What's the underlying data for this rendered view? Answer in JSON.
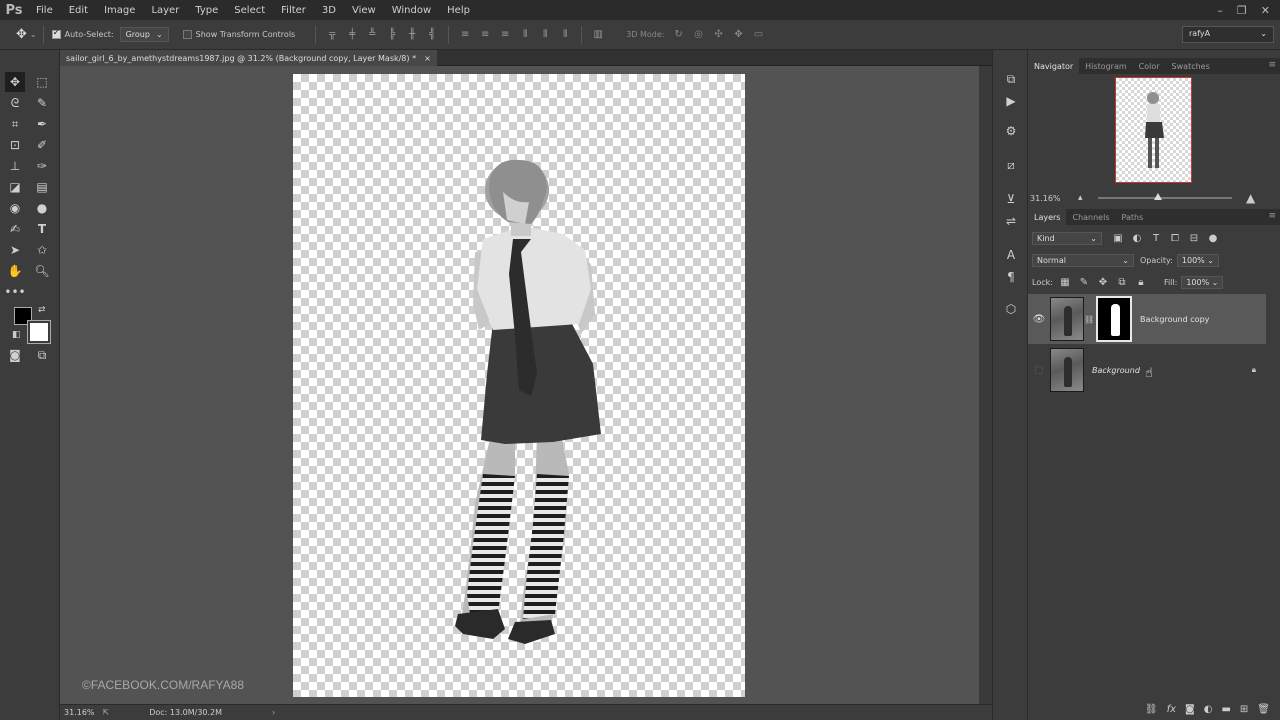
{
  "app": {
    "logo": "Ps"
  },
  "menu": [
    "File",
    "Edit",
    "Image",
    "Layer",
    "Type",
    "Select",
    "Filter",
    "3D",
    "View",
    "Window",
    "Help"
  ],
  "window_controls": [
    "–",
    "❐",
    "✕"
  ],
  "options": {
    "auto_select_label": "Auto-Select:",
    "auto_select_value": "Group",
    "show_transform_label": "Show Transform Controls",
    "mode_3d_label": "3D Mode:",
    "workspace": "rafyA"
  },
  "document": {
    "tab_title": "sailor_girl_6_by_amethystdreams1987.jpg @ 31.2% (Background copy, Layer Mask/8) *",
    "tab_close": "×",
    "watermark": "©FACEBOOK.COM/RAFYA88"
  },
  "status": {
    "zoom": "31.16%",
    "doc": "Doc: 13.0M/30.2M"
  },
  "navigator": {
    "tabs": [
      "Navigator",
      "Histogram",
      "Color",
      "Swatches"
    ],
    "active_tab": "Navigator",
    "zoom": "31.16%",
    "zoom_slider_level": 0.45
  },
  "layers_panel": {
    "tabs": [
      "Layers",
      "Channels",
      "Paths"
    ],
    "active_tab": "Layers",
    "filter_kind": "Kind",
    "blend_mode": "Normal",
    "opacity_label": "Opacity:",
    "opacity": "100%",
    "lock_label": "Lock:",
    "fill_label": "Fill:",
    "fill": "100%",
    "layers": [
      {
        "name": "Background copy",
        "visible": true,
        "has_mask": true,
        "selected": true
      },
      {
        "name": "Background",
        "visible": false,
        "locked": true,
        "italic": true
      }
    ]
  },
  "colors": {
    "accent": "#c33333",
    "panel": "#3c3c3c",
    "canvas_bg": "#535353"
  }
}
